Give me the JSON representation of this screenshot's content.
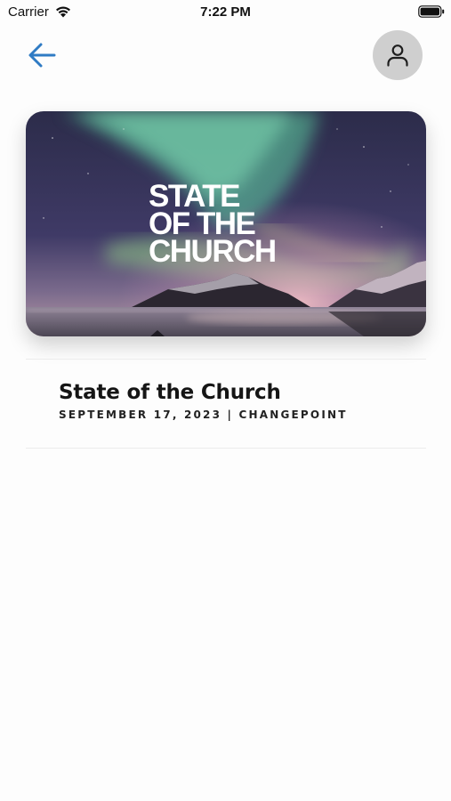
{
  "status_bar": {
    "carrier": "Carrier",
    "time": "7:22 PM",
    "wifi_icon": "wifi-icon",
    "battery_icon": "battery-icon"
  },
  "nav": {
    "back_icon": "arrow-left-icon",
    "profile_icon": "person-icon",
    "accent_color": "#2f7bc4"
  },
  "hero": {
    "title_lines": [
      "STATE",
      "OF THE",
      "CHURCH"
    ],
    "image": "aurora-over-mountains-lake"
  },
  "sermon": {
    "title": "State of the Church",
    "meta": "SEPTEMBER 17, 2023 | CHANGEPOINT"
  }
}
